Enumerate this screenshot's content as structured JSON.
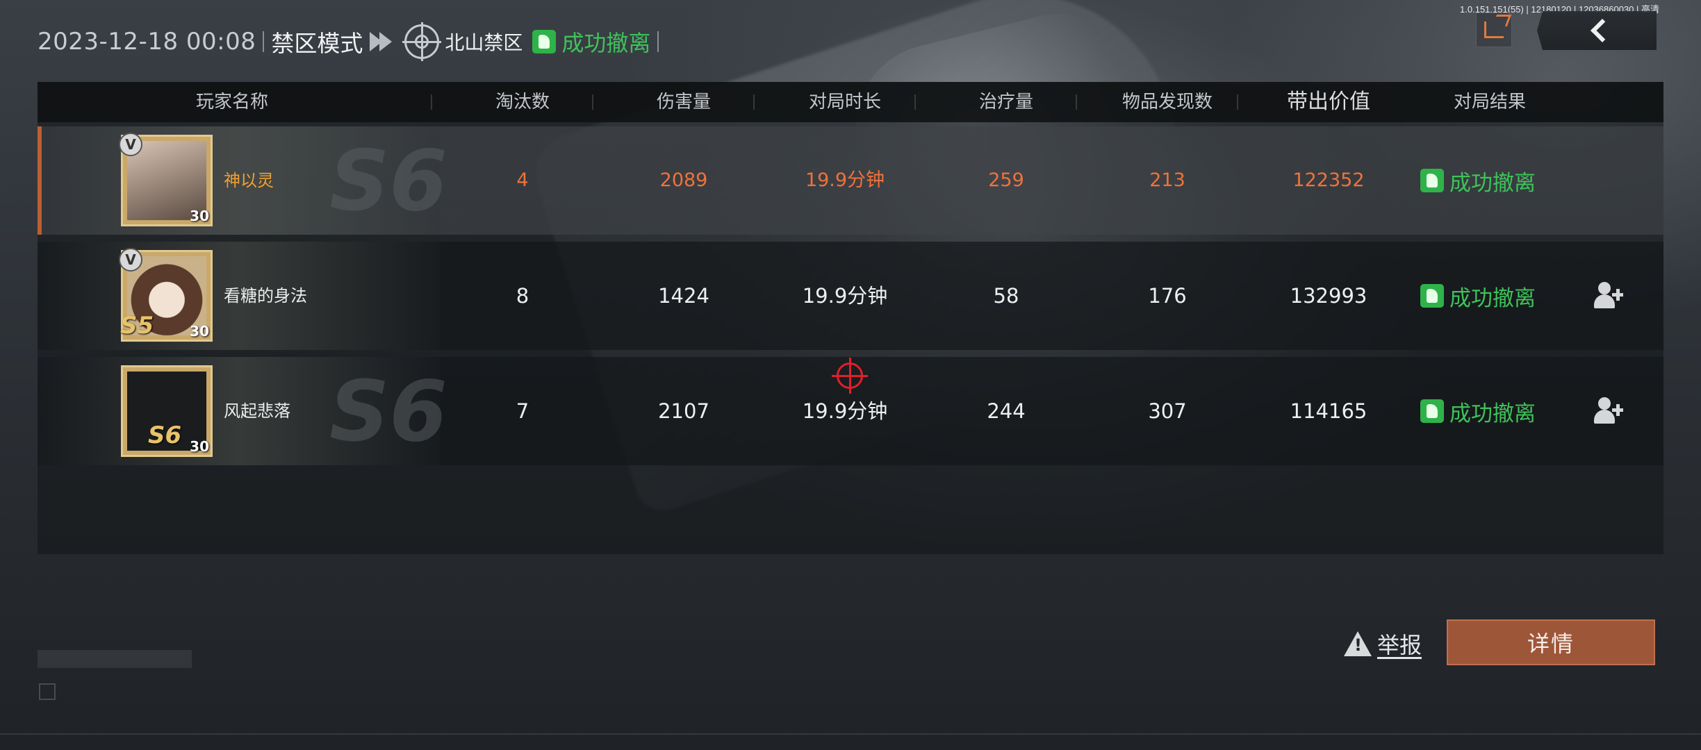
{
  "header": {
    "datetime": "2023-12-18 00:08",
    "mode": "禁区模式",
    "map": "北山禁区",
    "result": "成功撤离"
  },
  "server_info": "1.0.151.151(55) | 12180120 | 12036860030 | 高清",
  "columns": [
    "玩家名称",
    "淘汰数",
    "伤害量",
    "对局时长",
    "治疗量",
    "物品发现数",
    "带出价值",
    "对局结果"
  ],
  "players": [
    {
      "name": "神以灵",
      "level": "30",
      "badge": "V",
      "season": "",
      "kills": "4",
      "damage": "2089",
      "duration": "19.9分钟",
      "healing": "259",
      "items": "213",
      "value": "122352",
      "result": "成功撤离",
      "is_self": true
    },
    {
      "name": "看糖的身法",
      "level": "30",
      "badge": "V",
      "season": "S5",
      "kills": "8",
      "damage": "1424",
      "duration": "19.9分钟",
      "healing": "58",
      "items": "176",
      "value": "132993",
      "result": "成功撤离",
      "is_self": false
    },
    {
      "name": "风起悲落",
      "level": "30",
      "badge": "",
      "season": "S6",
      "kills": "7",
      "damage": "2107",
      "duration": "19.9分钟",
      "healing": "244",
      "items": "307",
      "value": "114165",
      "result": "成功撤离",
      "is_self": false
    }
  ],
  "buttons": {
    "report": "举报",
    "detail": "详情"
  },
  "colors": {
    "accent_orange": "#e0703a",
    "success_green": "#3ec25a",
    "detail_button": "#9e5639"
  }
}
